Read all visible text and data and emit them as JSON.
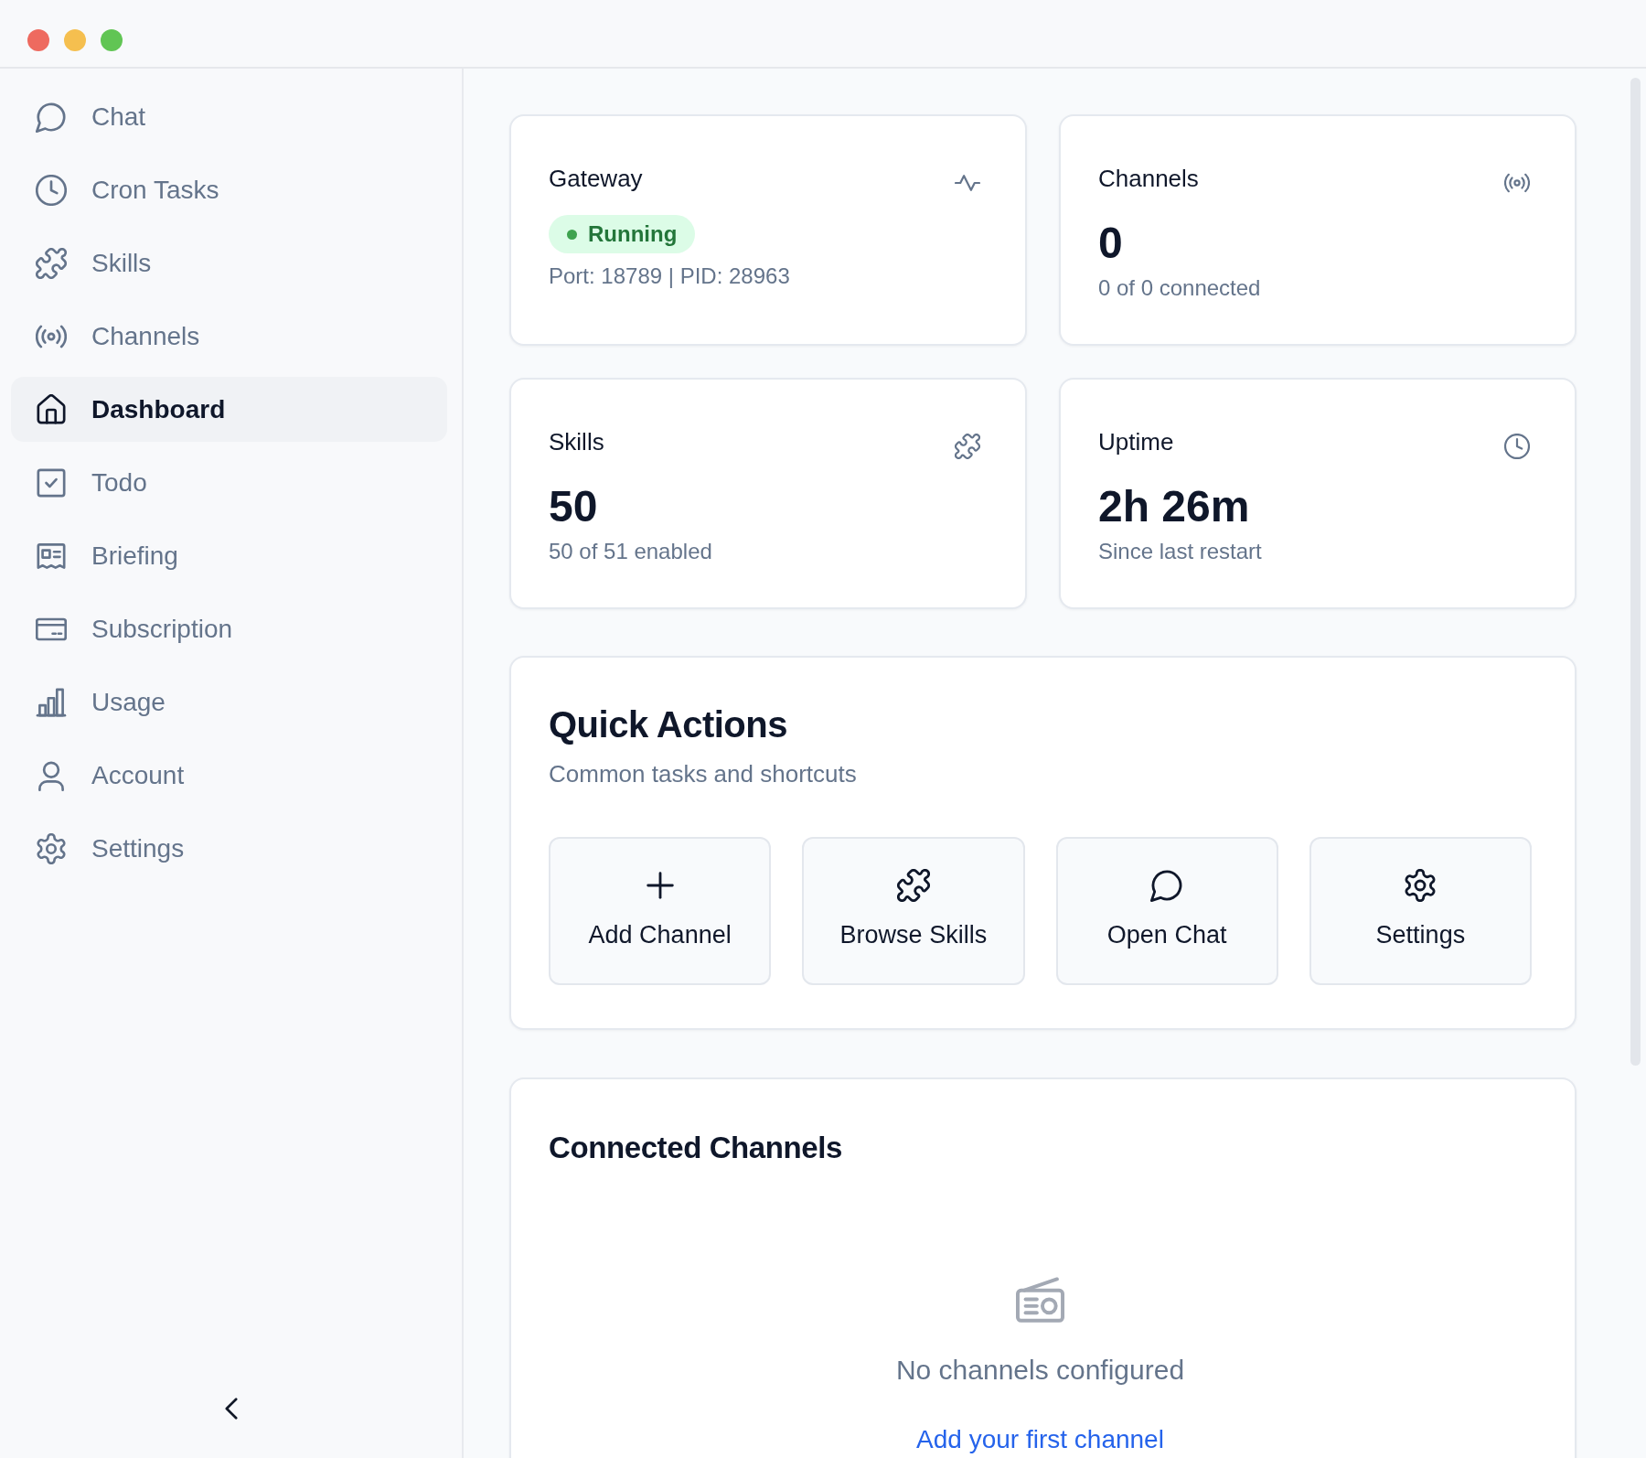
{
  "sidebar": {
    "items": [
      {
        "label": "Chat",
        "selected": false
      },
      {
        "label": "Cron Tasks",
        "selected": false
      },
      {
        "label": "Skills",
        "selected": false
      },
      {
        "label": "Channels",
        "selected": false
      },
      {
        "label": "Dashboard",
        "selected": true
      },
      {
        "label": "Todo",
        "selected": false
      },
      {
        "label": "Briefing",
        "selected": false
      },
      {
        "label": "Subscription",
        "selected": false
      },
      {
        "label": "Usage",
        "selected": false
      },
      {
        "label": "Account",
        "selected": false
      },
      {
        "label": "Settings",
        "selected": false
      }
    ]
  },
  "stats": [
    {
      "kind": "status",
      "title": "Gateway",
      "badge": "Running",
      "detail": "Port: 18789 | PID: 28963"
    },
    {
      "kind": "number",
      "title": "Channels",
      "value": "0",
      "detail": "0 of 0 connected"
    },
    {
      "kind": "number",
      "title": "Skills",
      "value": "50",
      "detail": "50 of 51 enabled"
    },
    {
      "kind": "number",
      "title": "Uptime",
      "value": "2h 26m",
      "detail": "Since last restart"
    }
  ],
  "quick_actions": {
    "title": "Quick Actions",
    "subtitle": "Common tasks and shortcuts",
    "buttons": [
      {
        "label": "Add Channel"
      },
      {
        "label": "Browse Skills"
      },
      {
        "label": "Open Chat"
      },
      {
        "label": "Settings"
      }
    ]
  },
  "connected_channels": {
    "title": "Connected Channels",
    "empty_message": "No channels configured",
    "link": "Add your first channel"
  }
}
